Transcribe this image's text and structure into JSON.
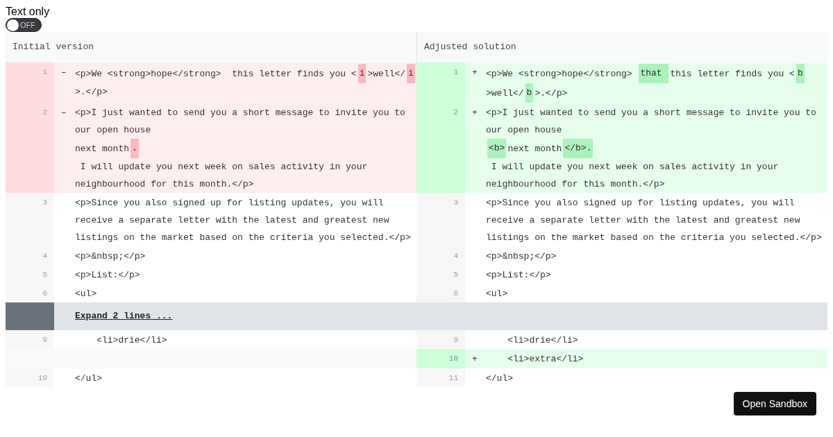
{
  "toggle": {
    "label": "Text only",
    "on": false,
    "state_text": "OFF"
  },
  "diff": {
    "columns": [
      "Initial version",
      "Adjusted solution"
    ],
    "rows": [
      {
        "kind": "change",
        "left": {
          "number": "1",
          "sign": "–",
          "lines": [
            [
              {
                "text": "<p>We <strong>hope</strong>  this letter finds you <",
                "highlight": false
              },
              {
                "text": "i",
                "highlight": true
              },
              {
                "text": ">well</",
                "highlight": false
              },
              {
                "text": "i",
                "highlight": true
              }
            ],
            [
              {
                "text": ">.</p>",
                "highlight": false
              }
            ]
          ]
        },
        "right": {
          "number": "1",
          "sign": "+",
          "lines": [
            [
              {
                "text": "<p>We <strong>hope</strong> ",
                "highlight": false
              },
              {
                "text": "that ",
                "highlight": true
              },
              {
                "text": "this letter finds you <",
                "highlight": false
              },
              {
                "text": "b",
                "highlight": true
              }
            ],
            [
              {
                "text": ">well</",
                "highlight": false
              },
              {
                "text": "b",
                "highlight": true
              },
              {
                "text": ">.</p>",
                "highlight": false
              }
            ]
          ]
        }
      },
      {
        "kind": "change",
        "left": {
          "number": "2",
          "sign": "–",
          "lines": [
            [
              {
                "text": "<p>I just wanted to send you a short message to invite you to",
                "highlight": false
              }
            ],
            [
              {
                "text": "our open house",
                "highlight": false
              }
            ],
            [
              {
                "text": "next month",
                "highlight": false
              },
              {
                "text": ".",
                "highlight": true
              }
            ],
            [
              {
                "text": " I will update you next week on sales activity in your",
                "highlight": false
              }
            ],
            [
              {
                "text": "neighbourhood for this month.</p>",
                "highlight": false
              }
            ]
          ]
        },
        "right": {
          "number": "2",
          "sign": "+",
          "lines": [
            [
              {
                "text": "<p>I just wanted to send you a short message to invite you to",
                "highlight": false
              }
            ],
            [
              {
                "text": "our open house",
                "highlight": false
              }
            ],
            [
              {
                "text": "<b>",
                "highlight": true
              },
              {
                "text": "next month",
                "highlight": false
              },
              {
                "text": "</b>.",
                "highlight": true
              }
            ],
            [
              {
                "text": " I will update you next week on sales activity in your",
                "highlight": false
              }
            ],
            [
              {
                "text": "neighbourhood for this month.</p>",
                "highlight": false
              }
            ]
          ]
        }
      },
      {
        "kind": "context",
        "left": {
          "number": "3",
          "lines": [
            "<p>Since you also signed up for listing updates, you will",
            "receive a separate letter with the latest and greatest new",
            "listings on the market based on the criteria you selected.</p>"
          ]
        },
        "right": {
          "number": "3",
          "lines": [
            "<p>Since you also signed up for listing updates, you will",
            "receive a separate letter with the latest and greatest new",
            "listings on the market based on the criteria you selected.</p>"
          ]
        }
      },
      {
        "kind": "context",
        "left": {
          "number": "4",
          "lines": [
            "<p>&nbsp;</p>"
          ]
        },
        "right": {
          "number": "4",
          "lines": [
            "<p>&nbsp;</p>"
          ]
        }
      },
      {
        "kind": "context",
        "left": {
          "number": "5",
          "lines": [
            "<p>List:</p>"
          ]
        },
        "right": {
          "number": "5",
          "lines": [
            "<p>List:</p>"
          ]
        }
      },
      {
        "kind": "context",
        "left": {
          "number": "6",
          "lines": [
            "<ul>"
          ]
        },
        "right": {
          "number": "6",
          "lines": [
            "<ul>"
          ]
        }
      },
      {
        "kind": "expand",
        "label": "Expand 2 lines ..."
      },
      {
        "kind": "context",
        "left": {
          "number": "9",
          "lines": [
            "    <li>drie</li>"
          ]
        },
        "right": {
          "number": "9",
          "lines": [
            "    <li>drie</li>"
          ]
        }
      },
      {
        "kind": "added",
        "right": {
          "number": "10",
          "sign": "+",
          "lines": [
            "    <li>extra</li>"
          ]
        }
      },
      {
        "kind": "context",
        "left": {
          "number": "10",
          "lines": [
            "</ul>"
          ]
        },
        "right": {
          "number": "11",
          "lines": [
            "</ul>"
          ]
        }
      }
    ]
  },
  "button": {
    "label": "Open Sandbox"
  }
}
